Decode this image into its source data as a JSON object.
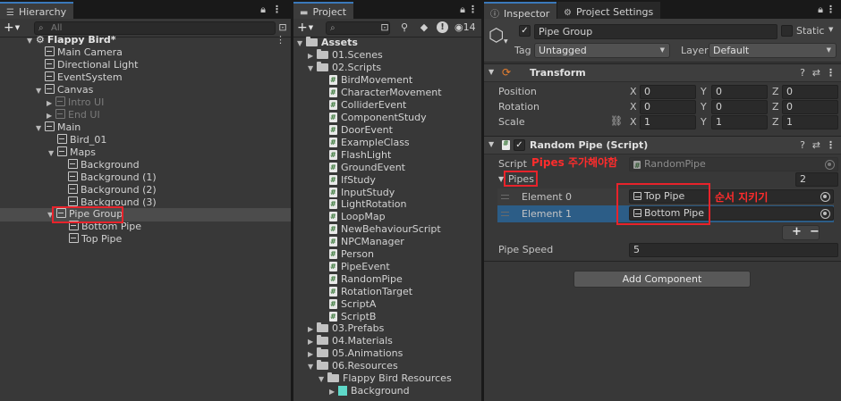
{
  "hierarchy": {
    "tab_label": "Hierarchy",
    "search_placeholder": "All",
    "scene_name": "Flappy Bird*",
    "items": [
      {
        "label": "Main Camera",
        "depth": 1
      },
      {
        "label": "Directional Light",
        "depth": 1
      },
      {
        "label": "EventSystem",
        "depth": 1
      },
      {
        "label": "Canvas",
        "depth": 1
      },
      {
        "label": "Intro UI",
        "depth": 2
      },
      {
        "label": "End UI",
        "depth": 2
      },
      {
        "label": "Main",
        "depth": 1
      },
      {
        "label": "Bird_01",
        "depth": 2
      },
      {
        "label": "Maps",
        "depth": 2
      },
      {
        "label": "Background",
        "depth": 3
      },
      {
        "label": "Background (1)",
        "depth": 3
      },
      {
        "label": "Background (2)",
        "depth": 3
      },
      {
        "label": "Background (3)",
        "depth": 3
      },
      {
        "label": "Pipe Group",
        "depth": 1
      },
      {
        "label": "Bottom Pipe",
        "depth": 2
      },
      {
        "label": "Top Pipe",
        "depth": 2
      }
    ]
  },
  "project": {
    "tab_label": "Project",
    "count_badge": "14",
    "items": [
      {
        "label": "Assets",
        "type": "folder",
        "depth": 0
      },
      {
        "label": "01.Scenes",
        "type": "folder",
        "depth": 1
      },
      {
        "label": "02.Scripts",
        "type": "folder",
        "depth": 1
      },
      {
        "label": "BirdMovement",
        "type": "script",
        "depth": 2
      },
      {
        "label": "CharacterMovement",
        "type": "script",
        "depth": 2
      },
      {
        "label": "ColliderEvent",
        "type": "script",
        "depth": 2
      },
      {
        "label": "ComponentStudy",
        "type": "script",
        "depth": 2
      },
      {
        "label": "DoorEvent",
        "type": "script",
        "depth": 2
      },
      {
        "label": "ExampleClass",
        "type": "script",
        "depth": 2
      },
      {
        "label": "FlashLight",
        "type": "script",
        "depth": 2
      },
      {
        "label": "GroundEvent",
        "type": "script",
        "depth": 2
      },
      {
        "label": "IfStudy",
        "type": "script",
        "depth": 2
      },
      {
        "label": "InputStudy",
        "type": "script",
        "depth": 2
      },
      {
        "label": "LightRotation",
        "type": "script",
        "depth": 2
      },
      {
        "label": "LoopMap",
        "type": "script",
        "depth": 2
      },
      {
        "label": "NewBehaviourScript",
        "type": "script",
        "depth": 2
      },
      {
        "label": "NPCManager",
        "type": "script",
        "depth": 2
      },
      {
        "label": "Person",
        "type": "script",
        "depth": 2
      },
      {
        "label": "PipeEvent",
        "type": "script",
        "depth": 2
      },
      {
        "label": "RandomPipe",
        "type": "script",
        "depth": 2
      },
      {
        "label": "RotationTarget",
        "type": "script",
        "depth": 2
      },
      {
        "label": "ScriptA",
        "type": "script",
        "depth": 2
      },
      {
        "label": "ScriptB",
        "type": "script",
        "depth": 2
      },
      {
        "label": "03.Prefabs",
        "type": "folder",
        "depth": 1
      },
      {
        "label": "04.Materials",
        "type": "folder",
        "depth": 1
      },
      {
        "label": "05.Animations",
        "type": "folder",
        "depth": 1
      },
      {
        "label": "06.Resources",
        "type": "folder",
        "depth": 1
      },
      {
        "label": "Flappy Bird Resources",
        "type": "folder",
        "depth": 2
      },
      {
        "label": "Background",
        "type": "texture",
        "depth": 3
      }
    ]
  },
  "inspector": {
    "tab_label": "Inspector",
    "tab2_label": "Project Settings",
    "object_name": "Pipe Group",
    "static_label": "Static",
    "tag_label": "Tag",
    "tag_value": "Untagged",
    "layer_label": "Layer",
    "layer_value": "Default",
    "transform": {
      "title": "Transform",
      "position_label": "Position",
      "rotation_label": "Rotation",
      "scale_label": "Scale",
      "position": {
        "x": "0",
        "y": "0",
        "z": "0"
      },
      "rotation": {
        "x": "0",
        "y": "0",
        "z": "0"
      },
      "scale": {
        "x": "1",
        "y": "1",
        "z": "1"
      }
    },
    "random_pipe": {
      "title": "Random Pipe (Script)",
      "script_label": "Script",
      "script_value": "RandomPipe",
      "pipes_label": "Pipes",
      "pipes_count": "2",
      "elements": [
        {
          "label": "Element 0",
          "value": "Top Pipe"
        },
        {
          "label": "Element 1",
          "value": "Bottom Pipe"
        }
      ],
      "add_label": "+",
      "remove_label": "−",
      "pipe_speed_label": "Pipe Speed",
      "pipe_speed_value": "5"
    },
    "add_component_label": "Add Component"
  },
  "annotations": {
    "pipes_note": "Pipes 주가해야함",
    "order_note": "순서 지키기"
  },
  "colors": {
    "accent_tab": "#3a79bb",
    "selection": "#2c5d87",
    "annotation_red": "#e8232b"
  }
}
